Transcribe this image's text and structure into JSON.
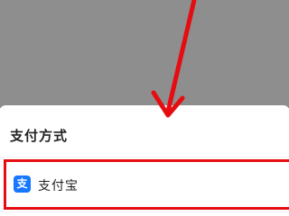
{
  "payment_sheet": {
    "title": "支付方式",
    "options": [
      {
        "label": "支付宝",
        "icon_glyph": "支",
        "icon": "alipay-icon",
        "icon_color": "#1677ff"
      }
    ]
  },
  "annotation": {
    "color": "#e50d12",
    "icon": "down-arrow-annotation"
  },
  "backdrop_color": "#8e8e8e"
}
